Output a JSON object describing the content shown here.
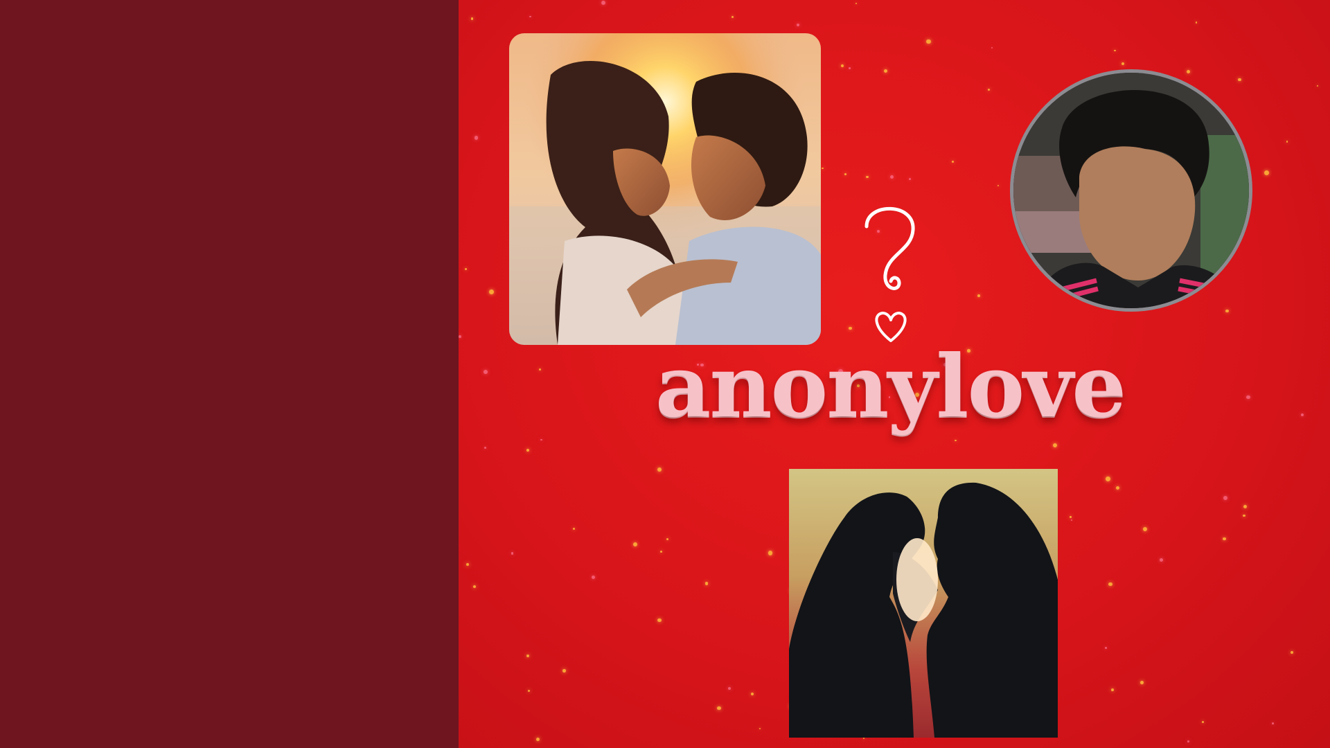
{
  "canvas": {
    "left_panel_color": "#6e1520",
    "background_color": "#e01818"
  },
  "brand": {
    "name": "anonylove",
    "color": "#f7c1c8"
  },
  "images": {
    "sunset_couple": {
      "description_icon": "couple-sunset-photo"
    },
    "profile": {
      "description_icon": "profile-avatar-photo"
    },
    "silhouette_couple": {
      "description_icon": "couple-silhouette-photo"
    }
  },
  "doodle": {
    "icon": "question-heart-icon"
  }
}
